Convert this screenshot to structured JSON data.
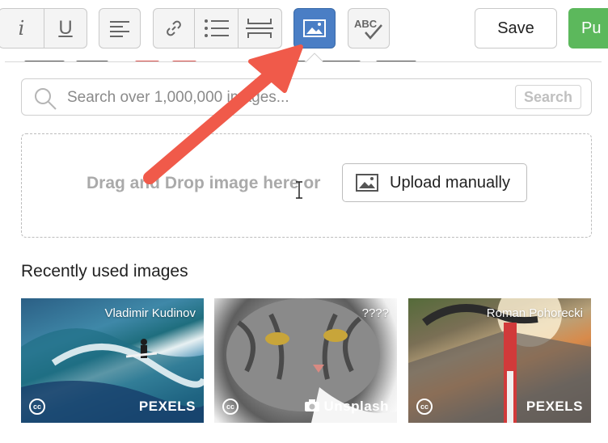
{
  "toolbar": {
    "italic_label": "i",
    "underline_label": "U",
    "save_label": "Save",
    "publish_label": "Pu",
    "buttons": [
      "italic-icon",
      "underline-icon",
      "align-left-icon",
      "link-icon",
      "bulleted-list-icon",
      "horizontal-rule-icon",
      "image-icon",
      "spellcheck-icon"
    ]
  },
  "colors": {
    "active_button": "#4a7ec5",
    "publish": "#5cb85c",
    "arrow": "#f05a4a"
  },
  "search": {
    "placeholder": "Search over 1,000,000 images...",
    "button_label": "Search"
  },
  "dropzone": {
    "text": "Drag and Drop image here or",
    "upload_label": "Upload manually"
  },
  "recent": {
    "title": "Recently used images",
    "images": [
      {
        "author": "Vladimir Kudinov",
        "source": "PEXELS",
        "license": "cc"
      },
      {
        "author": "????",
        "source": "Unsplash",
        "license": "cc"
      },
      {
        "author": "Roman Pohorecki",
        "source": "PEXELS",
        "license": "cc"
      }
    ]
  }
}
